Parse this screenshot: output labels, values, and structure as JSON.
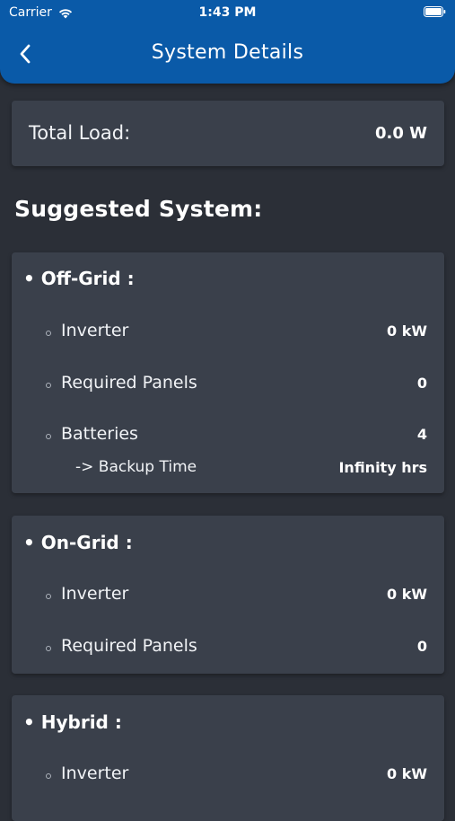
{
  "status_bar": {
    "carrier": "Carrier",
    "time": "1:43 PM"
  },
  "nav": {
    "title": "System Details",
    "back_icon": "chevron-left-icon"
  },
  "total": {
    "label": "Total Load:",
    "value": "0.0 W"
  },
  "suggested_title": "Suggested System:",
  "off_grid": {
    "title": "• Off-Grid :",
    "inverter_label": "Inverter",
    "inverter_value": "0 kW",
    "panels_label": "Required Panels",
    "panels_value": "0",
    "batteries_label": "Batteries",
    "batteries_value": "4",
    "backup_label": "-> Backup Time",
    "backup_value": "Infinity hrs"
  },
  "on_grid": {
    "title": "• On-Grid :",
    "inverter_label": "Inverter",
    "inverter_value": "0 kW",
    "panels_label": "Required Panels",
    "panels_value": "0"
  },
  "hybrid": {
    "title": "• Hybrid :",
    "inverter_label": "Inverter",
    "inverter_value": "0 kW"
  },
  "colors": {
    "header": "#0a5aa8",
    "background": "#2b2f37",
    "card": "#3a404b"
  }
}
